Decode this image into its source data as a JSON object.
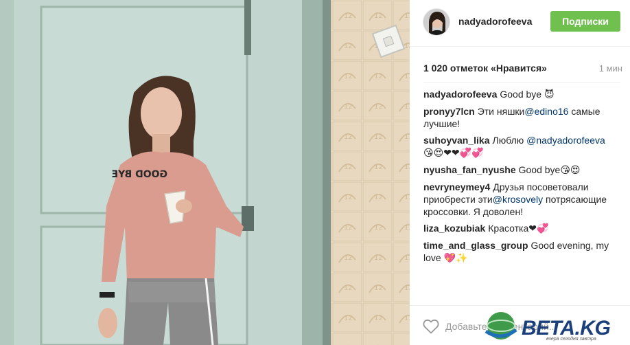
{
  "post": {
    "username": "nadyadorofeeva",
    "follow_label": "Подписки",
    "likes": "1 020 отметок «Нравится»",
    "time": "1 мин",
    "comment_placeholder": "Добавьте комментарий..."
  },
  "photo": {
    "shirt_text": "GOOD BYE"
  },
  "comments": [
    {
      "author": "nadyadorofeeva",
      "parts": [
        "Good bye ",
        "",
        ""
      ],
      "emoji": "😈"
    },
    {
      "author": "pronyy7lcn",
      "parts": [
        "Эти няшки",
        "@edino16",
        " самые лучшие!"
      ],
      "emoji": ""
    },
    {
      "author": "suhoyvan_lika",
      "parts": [
        "Люблю ",
        "@nadyadorofeeva",
        ""
      ],
      "emoji": "😘😍❤❤💞💞"
    },
    {
      "author": "nyusha_fan_nyushe",
      "parts": [
        "Good bye",
        "",
        ""
      ],
      "emoji": "😘😍"
    },
    {
      "author": "nevryneymey4",
      "parts": [
        "Друзья посоветовали приобрести эти",
        "@krosovely",
        " потрясающие кроссовки. Я доволен!"
      ],
      "emoji": ""
    },
    {
      "author": "liza_kozubiak",
      "parts": [
        "Красотка",
        "",
        ""
      ],
      "emoji": "❤💞"
    },
    {
      "author": "time_and_glass_group",
      "parts": [
        "Good evening, my love ",
        "",
        ""
      ],
      "emoji": "💖✨"
    }
  ],
  "watermark": {
    "brand": "BETA.KG",
    "tagline": "вчера сегодня завтра"
  },
  "colors": {
    "follow_green": "#70c050",
    "mention_blue": "#003569",
    "muted_gray": "#999999",
    "text_dark": "#262626"
  }
}
